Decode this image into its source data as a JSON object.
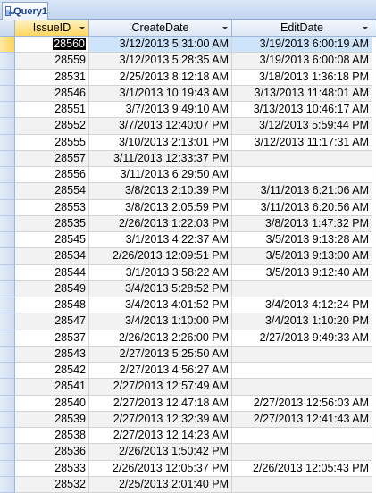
{
  "tab": {
    "title": "Query1",
    "icon": "query-icon"
  },
  "columns": [
    {
      "label": "IssueID"
    },
    {
      "label": "CreateDate"
    },
    {
      "label": "EditDate"
    }
  ],
  "rows": [
    {
      "id": "28560",
      "create": "3/12/2013 5:31:00 AM",
      "edit": "3/19/2013 6:00:19 AM"
    },
    {
      "id": "28559",
      "create": "3/12/2013 5:28:35 AM",
      "edit": "3/19/2013 6:00:08 AM"
    },
    {
      "id": "28531",
      "create": "2/25/2013 8:12:18 AM",
      "edit": "3/18/2013 1:36:18 PM"
    },
    {
      "id": "28546",
      "create": "3/1/2013 10:19:43 AM",
      "edit": "3/13/2013 11:48:01 AM"
    },
    {
      "id": "28551",
      "create": "3/7/2013 9:49:10 AM",
      "edit": "3/13/2013 10:46:17 AM"
    },
    {
      "id": "28552",
      "create": "3/7/2013 12:40:07 PM",
      "edit": "3/12/2013 5:59:44 PM"
    },
    {
      "id": "28555",
      "create": "3/10/2013 2:13:01 PM",
      "edit": "3/12/2013 11:17:31 AM"
    },
    {
      "id": "28557",
      "create": "3/11/2013 12:33:37 PM",
      "edit": ""
    },
    {
      "id": "28556",
      "create": "3/11/2013 6:29:50 AM",
      "edit": ""
    },
    {
      "id": "28554",
      "create": "3/8/2013 2:10:39 PM",
      "edit": "3/11/2013 6:21:06 AM"
    },
    {
      "id": "28553",
      "create": "3/8/2013 2:05:59 PM",
      "edit": "3/11/2013 6:20:56 AM"
    },
    {
      "id": "28535",
      "create": "2/26/2013 1:22:03 PM",
      "edit": "3/8/2013 1:47:32 PM"
    },
    {
      "id": "28545",
      "create": "3/1/2013 4:22:37 AM",
      "edit": "3/5/2013 9:13:28 AM"
    },
    {
      "id": "28534",
      "create": "2/26/2013 12:09:51 PM",
      "edit": "3/5/2013 9:13:00 AM"
    },
    {
      "id": "28544",
      "create": "3/1/2013 3:58:22 AM",
      "edit": "3/5/2013 9:12:40 AM"
    },
    {
      "id": "28549",
      "create": "3/4/2013 5:28:52 PM",
      "edit": ""
    },
    {
      "id": "28548",
      "create": "3/4/2013 4:01:52 PM",
      "edit": "3/4/2013 4:12:24 PM"
    },
    {
      "id": "28547",
      "create": "3/4/2013 1:10:00 PM",
      "edit": "3/4/2013 1:10:20 PM"
    },
    {
      "id": "28537",
      "create": "2/26/2013 2:26:00 PM",
      "edit": "2/27/2013 9:49:33 AM"
    },
    {
      "id": "28543",
      "create": "2/27/2013 5:25:50 AM",
      "edit": ""
    },
    {
      "id": "28542",
      "create": "2/27/2013 4:56:27 AM",
      "edit": ""
    },
    {
      "id": "28541",
      "create": "2/27/2013 12:57:49 AM",
      "edit": ""
    },
    {
      "id": "28540",
      "create": "2/27/2013 12:47:18 AM",
      "edit": "2/27/2013 12:56:03 AM"
    },
    {
      "id": "28539",
      "create": "2/27/2013 12:32:39 AM",
      "edit": "2/27/2013 12:41:43 AM"
    },
    {
      "id": "28538",
      "create": "2/27/2013 12:14:23 AM",
      "edit": ""
    },
    {
      "id": "28536",
      "create": "2/26/2013 1:50:42 PM",
      "edit": ""
    },
    {
      "id": "28533",
      "create": "2/26/2013 12:05:37 PM",
      "edit": "2/26/2013 12:05:43 PM"
    },
    {
      "id": "28532",
      "create": "2/25/2013 2:01:40 PM",
      "edit": ""
    }
  ],
  "current_row": 0,
  "colors": {
    "header_active": "#ffd65e",
    "current_row": "#cde4fb",
    "alt_row": "#f2f2f2"
  }
}
